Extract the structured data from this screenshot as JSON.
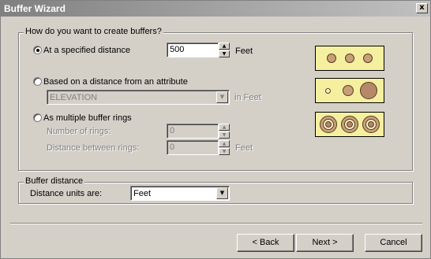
{
  "window": {
    "title": "Buffer Wizard",
    "close_label": "x"
  },
  "create_group": {
    "legend": "How do you want to create buffers?",
    "options": [
      {
        "label": "At a specified distance",
        "checked": true
      },
      {
        "label": "Based on a distance from an attribute",
        "checked": false
      },
      {
        "label": "As multiple buffer rings",
        "checked": false
      }
    ],
    "distance_value": "500",
    "distance_units": "Feet",
    "attribute_field": "ELEVATION",
    "attribute_units": "in Feet",
    "rings_count_label": "Number of rings:",
    "rings_count_value": "0",
    "rings_distance_label": "Distance between rings:",
    "rings_distance_value": "0",
    "rings_distance_units": "Feet"
  },
  "buffer_distance_group": {
    "legend": "Buffer distance",
    "units_label": "Distance units are:",
    "units_value": "Feet"
  },
  "buttons": {
    "back": "< Back",
    "next": "Next >",
    "cancel": "Cancel"
  },
  "glyphs": {
    "spin_up": "▲",
    "spin_down": "▼",
    "dropdown": "▼"
  },
  "colors": {
    "preview_bg": "#f4f0a0",
    "buffer_fill": "#c8a078"
  }
}
